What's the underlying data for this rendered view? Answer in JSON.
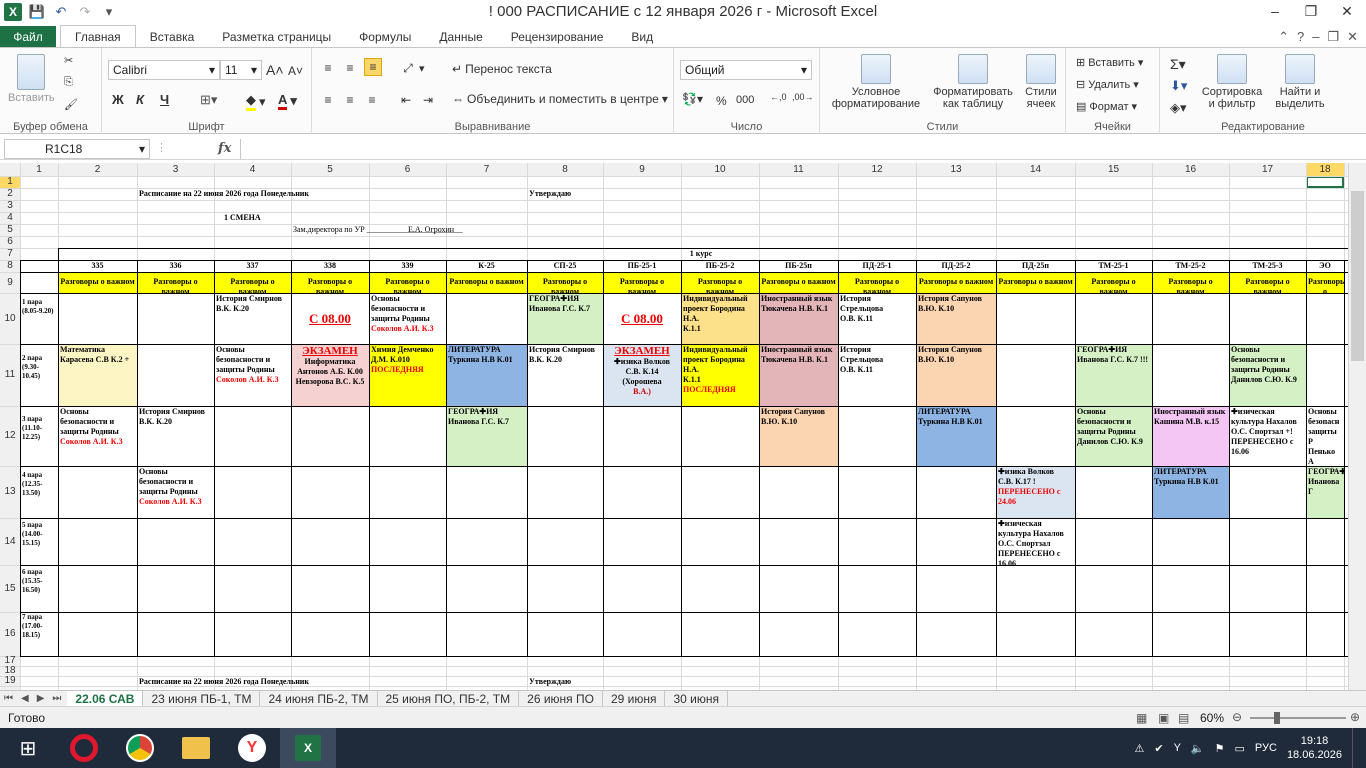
{
  "window": {
    "title": "! 000 РАСПИСАНИЕ с 12 января 2026 г  -  Microsoft Excel",
    "app_icon": "X"
  },
  "ribbon_tabs": [
    "Файл",
    "Главная",
    "Вставка",
    "Разметка страницы",
    "Формулы",
    "Данные",
    "Рецензирование",
    "Вид"
  ],
  "active_tab": "Главная",
  "ribbon": {
    "clipboard": {
      "label": "Буфер обмена",
      "paste": "Вставить"
    },
    "font": {
      "label": "Шрифт",
      "name": "Calibri",
      "size": "11",
      "bold": "Ж",
      "italic": "К",
      "underline": "Ч"
    },
    "alignment": {
      "label": "Выравнивание",
      "wrap": "Перенос текста",
      "merge": "Объединить и поместить в центре"
    },
    "number": {
      "label": "Число",
      "format": "Общий"
    },
    "styles": {
      "label": "Стили",
      "conditional": "Условное форматирование",
      "as_table": "Форматировать как таблицу",
      "cell_styles": "Стили ячеек"
    },
    "cells": {
      "label": "Ячейки",
      "insert": "Вставить",
      "delete": "Удалить",
      "format": "Формат"
    },
    "editing": {
      "label": "Редактирование",
      "sort": "Сортировка и фильтр",
      "find": "Найти и выделить"
    }
  },
  "formula_bar": {
    "name_box": "R1C18",
    "fx": "fx",
    "content": ""
  },
  "columns": [
    "1",
    "2",
    "3",
    "4",
    "5",
    "6",
    "7",
    "8",
    "9",
    "10",
    "11",
    "12",
    "13",
    "14",
    "15",
    "16",
    "17",
    "18"
  ],
  "rows": [
    "1",
    "2",
    "3",
    "4",
    "5",
    "6",
    "7",
    "8",
    "9",
    "10",
    "11",
    "12",
    "13",
    "14",
    "15",
    "16",
    "17",
    "18",
    "19"
  ],
  "sheet_texts": {
    "title": "Расписание на 22 июня 2026 года  Понедельник",
    "approve": "Утверждаю",
    "shift": "1 СМЕНА",
    "deputy": "Зам.директора по УР  ________________________",
    "signer": "Е.А. Огрохин",
    "course": "1 курс",
    "title2": "Расписание на 22 июня 2026 года  Понедельник",
    "approve2": "Утверждаю"
  },
  "groups": [
    "335",
    "336",
    "337",
    "338",
    "339",
    "К-25",
    "СП-25",
    "ПБ-25-1",
    "ПБ-25-2",
    "ПБ-25п",
    "ПД-25-1",
    "ПД-25-2",
    "ПД-25п",
    "ТМ-25-1",
    "ТМ-25-2",
    "ТМ-25-3",
    "ЭО"
  ],
  "talk_row": "Разговоры о важном",
  "periods": [
    "1 пара (8.05-9.20)",
    "2 пара (9.30-10.45)",
    "3 пара (11.10-12.25)",
    "4 пара (12.35-13.50)",
    "5 пара (14.00-15.15)",
    "6 пара (15.35-16.50)",
    "7 пара (17.00-18.15)"
  ],
  "schedule": [
    {
      "row": 0,
      "col": 2,
      "lines": [
        "История Смирнов",
        "В.К. К.20"
      ]
    },
    {
      "row": 0,
      "col": 3,
      "lines": [
        "С 08.00"
      ],
      "style": "big-red"
    },
    {
      "row": 0,
      "col": 4,
      "lines": [
        "Основы",
        "безопасности и",
        "защиты Родины",
        "Соколов А.И. К.3"
      ],
      "red_last": true
    },
    {
      "row": 0,
      "col": 6,
      "lines": [
        "ГЕОГРА✚ИЯ",
        "Иванова Г.С. К.7"
      ],
      "fill": "#d5f0c5"
    },
    {
      "row": 0,
      "col": 7,
      "lines": [
        "С 08.00"
      ],
      "style": "big-red"
    },
    {
      "row": 0,
      "col": 8,
      "lines": [
        "Индивидуальный",
        "проект Бородина Н.А.",
        "К.1.1"
      ],
      "fill": "#fde08a"
    },
    {
      "row": 0,
      "col": 9,
      "lines": [
        "Иностранный язык",
        "Тюкачева Н.В. К.1"
      ],
      "fill": "#e3b5b9"
    },
    {
      "row": 0,
      "col": 10,
      "lines": [
        "История Стрельцова",
        "О.В. К.11"
      ]
    },
    {
      "row": 0,
      "col": 11,
      "lines": [
        "История Сапунов",
        "В.Ю. К.10"
      ],
      "fill": "#fbd5b2"
    },
    {
      "row": 1,
      "col": 0,
      "lines": [
        "Математика",
        "Карасева С.В К.2 +"
      ],
      "fill": "#fdf5c4"
    },
    {
      "row": 1,
      "col": 2,
      "lines": [
        "Основы",
        "безопасности и",
        "защиты Родины",
        "Соколов А.И. К.3"
      ],
      "red_last": true
    },
    {
      "row": 1,
      "col": 3,
      "lines": [
        "ЭКЗАМЕН",
        "Информатика",
        "Антонов А.Б. К.00",
        "Невзорова В.С. К.5"
      ],
      "fill": "#f6d1d1",
      "style": "exam"
    },
    {
      "row": 1,
      "col": 4,
      "lines": [
        "Химия Демченко",
        "Д.М. К.010",
        "ПОСЛЕДНЯЯ"
      ],
      "fill": "#ffff00",
      "red_last": true
    },
    {
      "row": 1,
      "col": 5,
      "lines": [
        "ЛИТЕРАТУРА",
        "Туркина Н.В К.01"
      ],
      "fill": "#8eb4e3"
    },
    {
      "row": 1,
      "col": 6,
      "lines": [
        "История Смирнов",
        "В.К. К.20"
      ]
    },
    {
      "row": 1,
      "col": 7,
      "lines": [
        "ЭКЗАМЕН",
        "✚изика  Волков",
        "С.В. К.14 (Хорошева",
        "В.А.)"
      ],
      "fill": "#dbe5f1",
      "style": "exam"
    },
    {
      "row": 1,
      "col": 8,
      "lines": [
        "Индивидуальный",
        "проект Бородина Н.А.",
        "К.1.1",
        "ПОСЛЕДНЯЯ"
      ],
      "fill": "#ffff00",
      "red_last": true
    },
    {
      "row": 1,
      "col": 9,
      "lines": [
        "Иностранный язык",
        "Тюкачева Н.В. К.1"
      ],
      "fill": "#e3b5b9"
    },
    {
      "row": 1,
      "col": 10,
      "lines": [
        "История Стрельцова",
        "О.В. К.11"
      ]
    },
    {
      "row": 1,
      "col": 11,
      "lines": [
        "История Сапунов",
        "В.Ю. К.10"
      ],
      "fill": "#fbd5b2"
    },
    {
      "row": 1,
      "col": 13,
      "lines": [
        "ГЕОГРА✚ИЯ",
        "Иванова Г.С. К.7 !!!"
      ],
      "fill": "#d5f0c5"
    },
    {
      "row": 1,
      "col": 15,
      "lines": [
        "Основы",
        "безопасности и",
        "защиты Родины",
        "Данилов С.Ю. К.9"
      ],
      "fill": "#d5f0c5"
    },
    {
      "row": 2,
      "col": 0,
      "lines": [
        "Основы",
        "безопасности и",
        "защиты Родины",
        "Соколов А.И. К.3"
      ],
      "red_last": true
    },
    {
      "row": 2,
      "col": 1,
      "lines": [
        "История Смирнов",
        "В.К. К.20"
      ]
    },
    {
      "row": 2,
      "col": 5,
      "lines": [
        "ГЕОГРА✚ИЯ",
        "Иванова Г.С. К.7"
      ],
      "fill": "#d5f0c5"
    },
    {
      "row": 2,
      "col": 9,
      "lines": [
        "История Сапунов",
        "В.Ю. К.10"
      ],
      "fill": "#fbd5b2"
    },
    {
      "row": 2,
      "col": 11,
      "lines": [
        "ЛИТЕРАТУРА",
        "Туркина Н.В К.01"
      ],
      "fill": "#8eb4e3"
    },
    {
      "row": 2,
      "col": 13,
      "lines": [
        "Основы",
        "безопасности и",
        "защиты Родины",
        "Данилов С.Ю. К.9"
      ],
      "fill": "#d5f0c5"
    },
    {
      "row": 2,
      "col": 14,
      "lines": [
        "Иностранный язык",
        "Кашина М.В. к.15"
      ],
      "fill": "#f4c6f4"
    },
    {
      "row": 2,
      "col": 15,
      "lines": [
        "✚изическая",
        "культура Нахалов",
        "О.С. Спортзал +!",
        "ПЕРЕНЕСЕНО с",
        "16.06"
      ]
    },
    {
      "row": 2,
      "col": 16,
      "lines": [
        "Основы",
        "безопасн",
        "защиты Р",
        "Пенько А"
      ]
    },
    {
      "row": 3,
      "col": 1,
      "lines": [
        "Основы",
        "безопасности и",
        "защиты Родины",
        "Соколов А.И. К.3"
      ],
      "red_last": true
    },
    {
      "row": 3,
      "col": 12,
      "lines": [
        "✚изика   Волков",
        "С.В. К.17 !",
        "ПЕРЕНЕСЕНО с",
        "24.06"
      ],
      "fill": "#dbe5f1",
      "red_tail": 2
    },
    {
      "row": 3,
      "col": 14,
      "lines": [
        "ЛИТЕРАТУРА",
        "Туркина Н.В К.01"
      ],
      "fill": "#8eb4e3"
    },
    {
      "row": 3,
      "col": 16,
      "lines": [
        "ГЕОГРА✚",
        "Иванова Г"
      ],
      "fill": "#d5f0c5"
    },
    {
      "row": 4,
      "col": 12,
      "lines": [
        "✚изическая",
        "культура Нахалов",
        "О.С. Спортзал",
        "ПЕРЕНЕСЕНО с",
        "16.06"
      ]
    }
  ],
  "sheet_tabs": [
    "22.06 САВ",
    "23 июня ПБ-1, ТМ",
    "24 июня ПБ-2, ТМ",
    "25 июня ПО, ПБ-2, ТМ",
    "26 июня ПО",
    "29 июня",
    "30 июня"
  ],
  "active_sheet": "22.06 САВ",
  "status": {
    "ready": "Готово",
    "zoom": "60%"
  },
  "taskbar": {
    "lang": "РУС",
    "time": "19:18",
    "date": "18.06.2026"
  },
  "colors": {
    "excel_green": "#217346",
    "yellow": "#ffff00",
    "header_sel": "#ffd966"
  }
}
